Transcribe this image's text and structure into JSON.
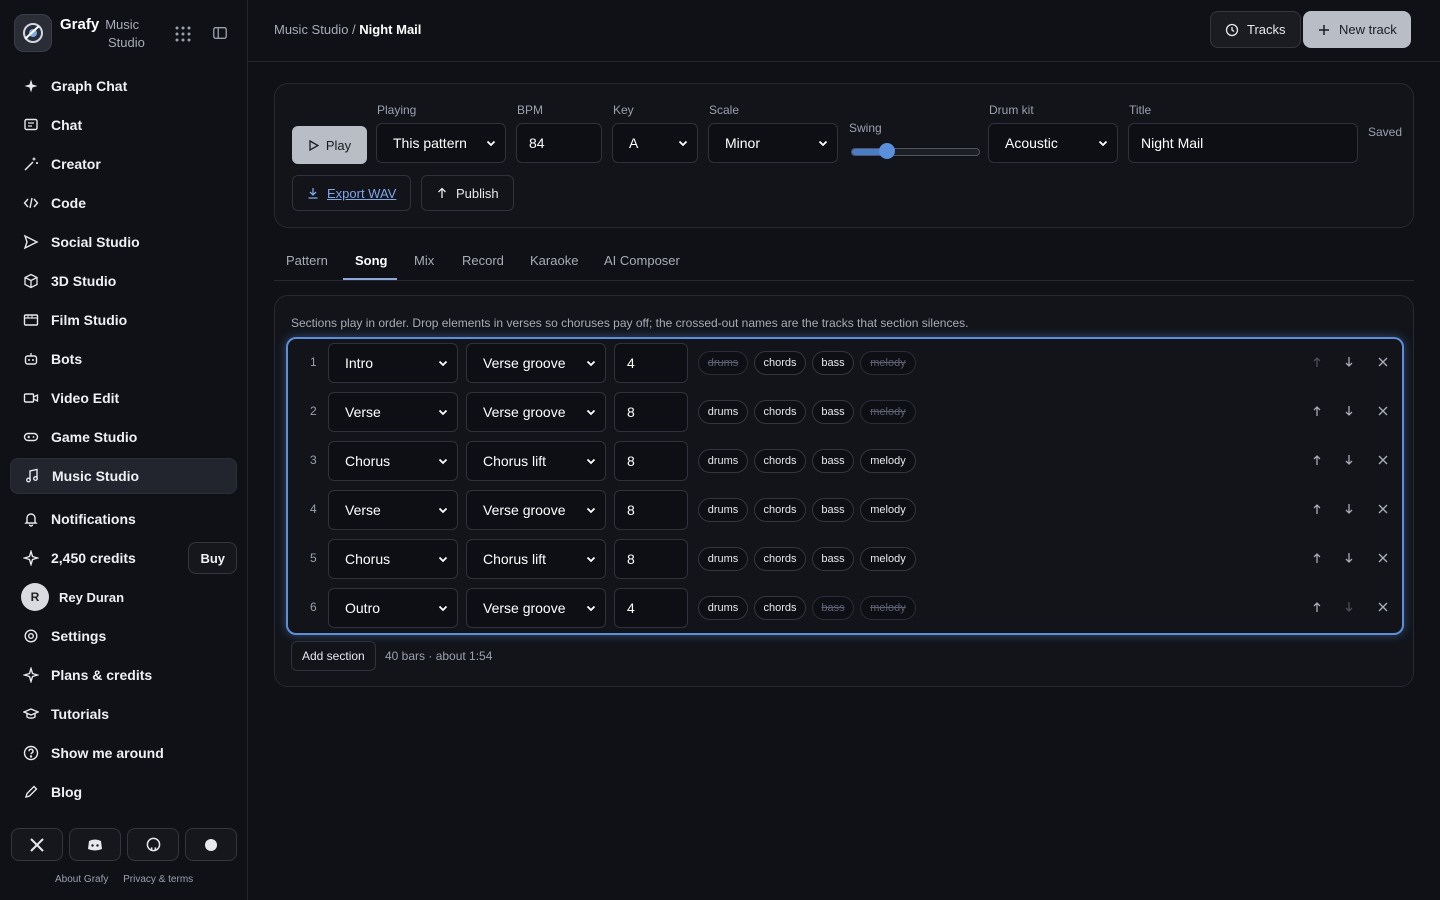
{
  "brand": {
    "name": "Grafy",
    "sub1": "Music",
    "sub2": "Studio"
  },
  "nav": [
    {
      "id": "graph-chat",
      "label": "Graph Chat",
      "icon": "sparkle-icon"
    },
    {
      "id": "chat",
      "label": "Chat",
      "icon": "chat-icon"
    },
    {
      "id": "creator",
      "label": "Creator",
      "icon": "wand-icon"
    },
    {
      "id": "code",
      "label": "Code",
      "icon": "code-icon"
    },
    {
      "id": "social-studio",
      "label": "Social Studio",
      "icon": "send-icon"
    },
    {
      "id": "3d-studio",
      "label": "3D Studio",
      "icon": "cube-icon"
    },
    {
      "id": "film-studio",
      "label": "Film Studio",
      "icon": "film-icon"
    },
    {
      "id": "bots",
      "label": "Bots",
      "icon": "bot-icon"
    },
    {
      "id": "video-edit",
      "label": "Video Edit",
      "icon": "video-icon"
    },
    {
      "id": "game-studio",
      "label": "Game Studio",
      "icon": "gamepad-icon"
    },
    {
      "id": "music-studio",
      "label": "Music Studio",
      "icon": "music-icon",
      "active": true
    }
  ],
  "nav2": {
    "notifications": "Notifications",
    "credits": "2,450 credits",
    "buy": "Buy",
    "user_initial": "R",
    "user_name": "Rey Duran",
    "settings": "Settings",
    "plans": "Plans & credits",
    "tutorials": "Tutorials",
    "tour": "Show me around",
    "blog": "Blog"
  },
  "footer": {
    "about": "About Grafy",
    "privacy": "Privacy & terms"
  },
  "header": {
    "crumb_parent": "Music Studio",
    "crumb_sep": "/",
    "crumb_current": "Night Mail",
    "tracks": "Tracks",
    "new_track": "New track"
  },
  "controls": {
    "play": "Play",
    "playing_label": "Playing",
    "playing_value": "This pattern",
    "bpm_label": "BPM",
    "bpm_value": "84",
    "key_label": "Key",
    "key_value": "A",
    "scale_label": "Scale",
    "scale_value": "Minor",
    "swing_label": "Swing",
    "swing_level": 0.28,
    "drumkit_label": "Drum kit",
    "drumkit_value": "Acoustic",
    "title_label": "Title",
    "title_value": "Night Mail",
    "saved": "Saved",
    "export": "Export WAV",
    "publish": "Publish"
  },
  "tabs": [
    "Pattern",
    "Song",
    "Mix",
    "Record",
    "Karaoke",
    "AI Composer"
  ],
  "active_tab": "Song",
  "song": {
    "hint": "Sections play in order. Drop elements in verses so choruses pay off; the crossed-out names are the tracks that section silences.",
    "sections": [
      {
        "num": "1",
        "section": "Intro",
        "pattern": "Verse groove",
        "bars": "4",
        "drums": false,
        "chords": true,
        "bass": true,
        "melody": false
      },
      {
        "num": "2",
        "section": "Verse",
        "pattern": "Verse groove",
        "bars": "8",
        "drums": true,
        "chords": true,
        "bass": true,
        "melody": false
      },
      {
        "num": "3",
        "section": "Chorus",
        "pattern": "Chorus lift",
        "bars": "8",
        "drums": true,
        "chords": true,
        "bass": true,
        "melody": true
      },
      {
        "num": "4",
        "section": "Verse",
        "pattern": "Verse groove",
        "bars": "8",
        "drums": true,
        "chords": true,
        "bass": true,
        "melody": true
      },
      {
        "num": "5",
        "section": "Chorus",
        "pattern": "Chorus lift",
        "bars": "8",
        "drums": true,
        "chords": true,
        "bass": true,
        "melody": true
      },
      {
        "num": "6",
        "section": "Outro",
        "pattern": "Verse groove",
        "bars": "4",
        "drums": true,
        "chords": true,
        "bass": false,
        "melody": false
      }
    ],
    "track_names": {
      "drums": "drums",
      "chords": "chords",
      "bass": "bass",
      "melody": "melody"
    },
    "add_section": "Add section",
    "summary": "40 bars · about 1:54"
  }
}
